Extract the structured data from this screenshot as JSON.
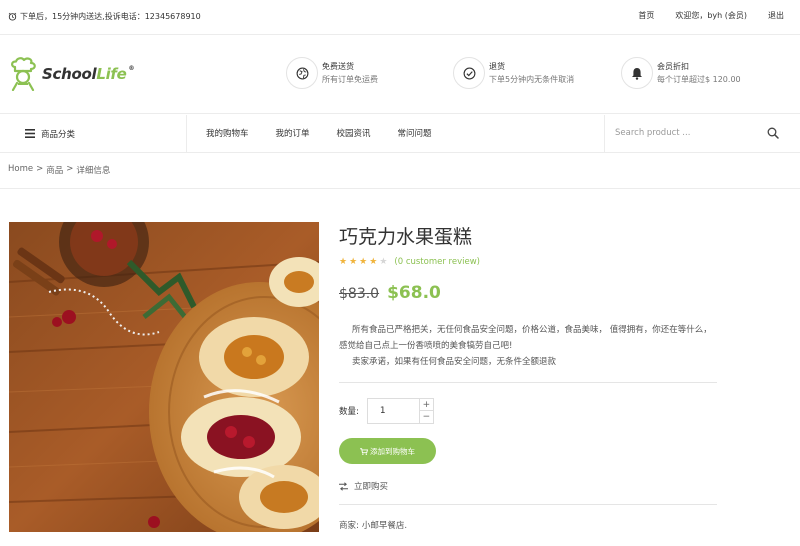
{
  "topbar": {
    "notice": "下单后，15分钟内送达,投诉电话：12345678910",
    "links": [
      "首页",
      "欢迎您，byh (会员)",
      "退出"
    ]
  },
  "header": {
    "logo_main": "School",
    "logo_accent": "Life",
    "logo_reg": "®",
    "features": [
      {
        "icon": "globe-icon",
        "title": "免费送货",
        "subtitle": "所有订单免运费"
      },
      {
        "icon": "check-circle-icon",
        "title": "退货",
        "subtitle": "下单5分钟内无条件取消"
      },
      {
        "icon": "bell-icon",
        "title": "会员折扣",
        "subtitle": "每个订单超过$ 120.00"
      }
    ]
  },
  "nav": {
    "category_label": "商品分类",
    "menu": [
      "我的购物车",
      "我的订单",
      "校园资讯",
      "常问问题"
    ],
    "search_placeholder": "Search product ..."
  },
  "breadcrumb": {
    "items": [
      "Home",
      "商品",
      "详细信息"
    ],
    "separator": ">"
  },
  "product": {
    "title": "巧克力水果蛋糕",
    "rating": 4,
    "rating_max": 5,
    "review_text": "(0 customer review)",
    "old_price": "$83.0",
    "new_price": "$68.0",
    "description": [
      "所有食品已严格把关，无任何食品安全问题，价格公道，食品美味， 值得拥有，你还在等什么， 感觉给自己点上一份香喷喷的美食犒劳自己吧!",
      "卖家承诺，如果有任何食品安全问题，无条件全额退款"
    ],
    "quantity_label": "数量:",
    "quantity_value": "1",
    "add_to_cart": "添加到购物车",
    "buy_now": "立即购买",
    "seller_label": "商家:",
    "seller_name": "小邮早餐店."
  },
  "colors": {
    "accent": "#8cc152",
    "star_filled": "#f0b43c",
    "star_empty": "#d6d6d6"
  }
}
